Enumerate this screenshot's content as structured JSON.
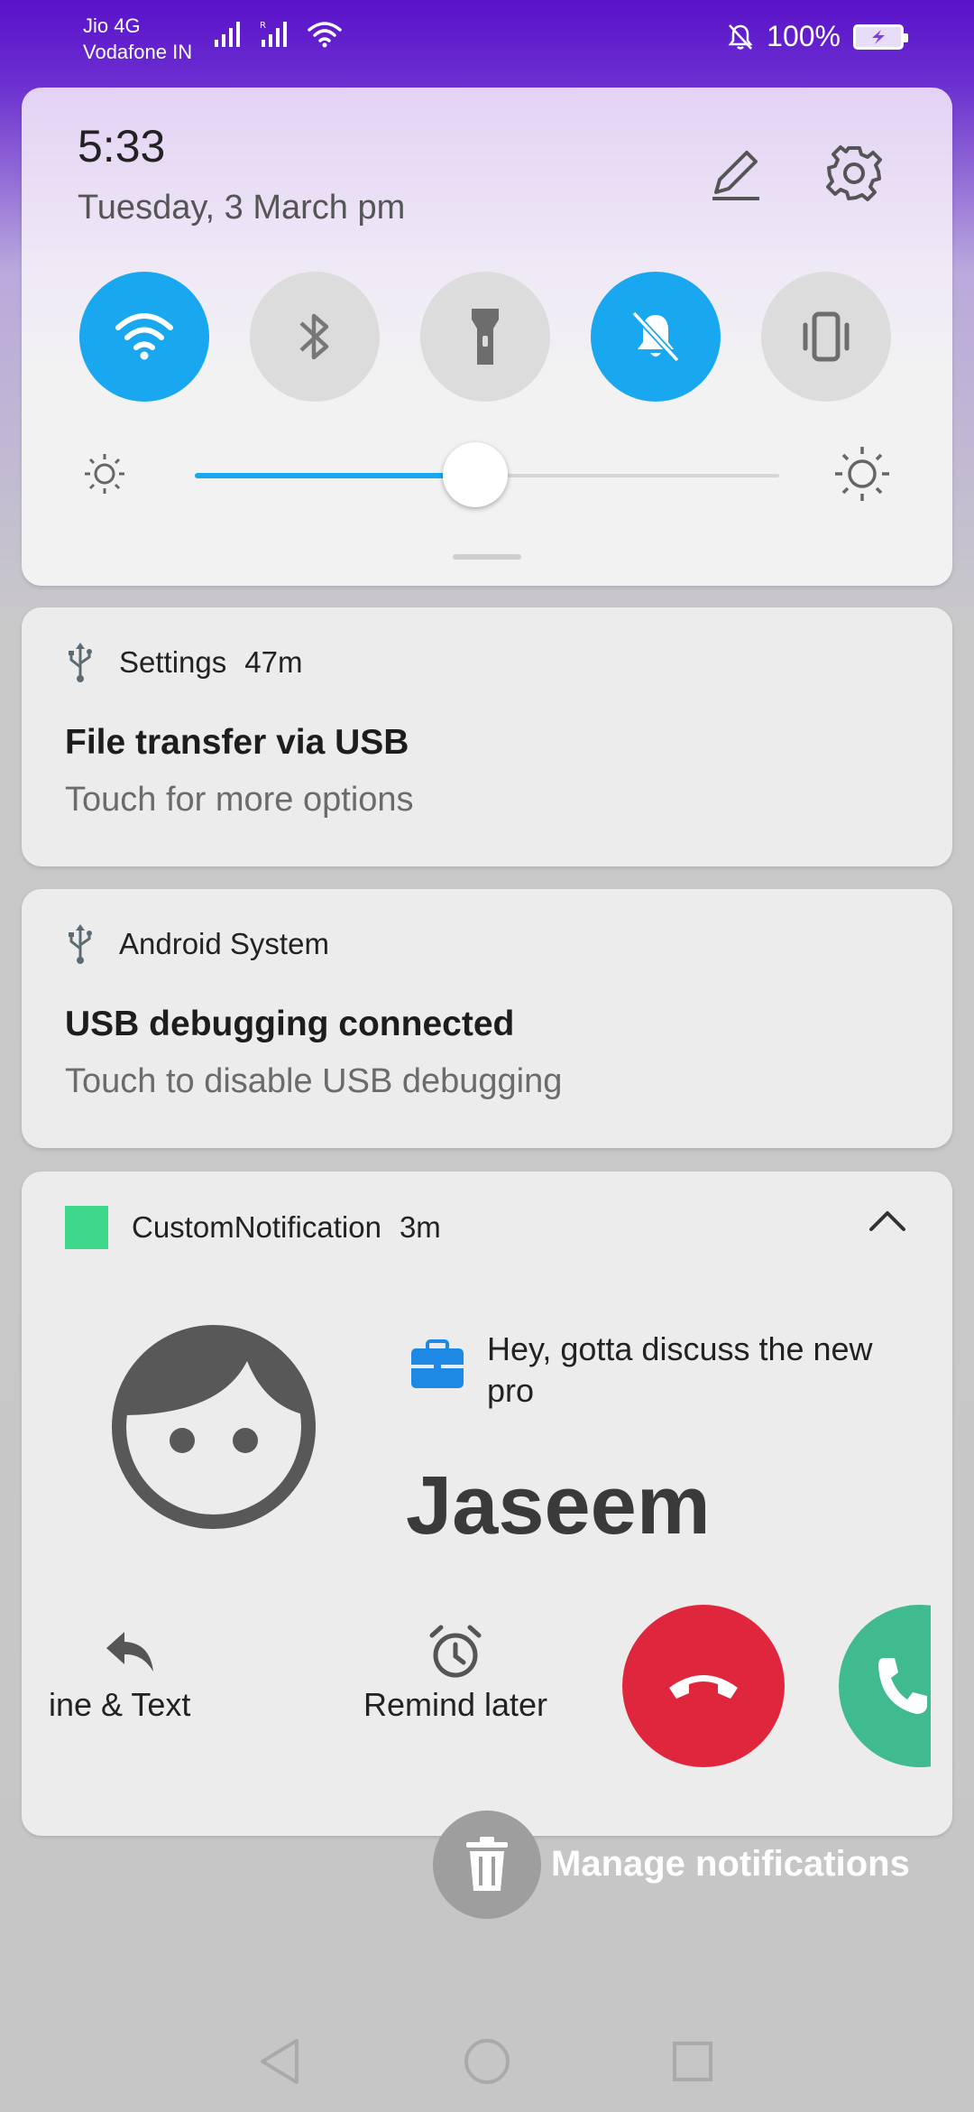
{
  "status_bar": {
    "carrier_1": "Jio 4G",
    "carrier_2": "Vodafone IN",
    "battery": "100%",
    "icons": [
      "signal-icon",
      "roaming-signal-icon",
      "wifi-icon",
      "mute-icon",
      "battery-charging-icon"
    ]
  },
  "quick_settings": {
    "time": "5:33",
    "date": "Tuesday, 3 March  pm",
    "edit_icon": "pencil-icon",
    "settings_icon": "gear-icon",
    "toggles": [
      {
        "name": "wifi",
        "icon": "wifi-icon",
        "on": true
      },
      {
        "name": "bluetooth",
        "icon": "bluetooth-icon",
        "on": false
      },
      {
        "name": "flashlight",
        "icon": "flashlight-icon",
        "on": false
      },
      {
        "name": "mute",
        "icon": "bell-off-icon",
        "on": true
      },
      {
        "name": "vibrate",
        "icon": "vibrate-icon",
        "on": false
      }
    ],
    "brightness_level": 0.48,
    "accent_color": "#19a8f0"
  },
  "notifications": [
    {
      "app": "Settings",
      "age": "47m",
      "icon": "usb-icon",
      "title": "File transfer via USB",
      "text": "Touch for more options"
    },
    {
      "app": "Android System",
      "age": "",
      "icon": "usb-icon",
      "title": "USB debugging connected",
      "text": "Touch to disable USB debugging"
    },
    {
      "app": "CustomNotification",
      "age": "3m",
      "icon": "green-square-icon",
      "message": "Hey, gotta discuss the new pro",
      "caller": "Jaseem",
      "actions": [
        "ine & Text",
        "Remind later"
      ],
      "decline_color": "#e0263c",
      "accept_color": "#3fbb8f"
    }
  ],
  "manage_label": "Manage notifications",
  "nav": [
    "back",
    "home",
    "recents"
  ]
}
